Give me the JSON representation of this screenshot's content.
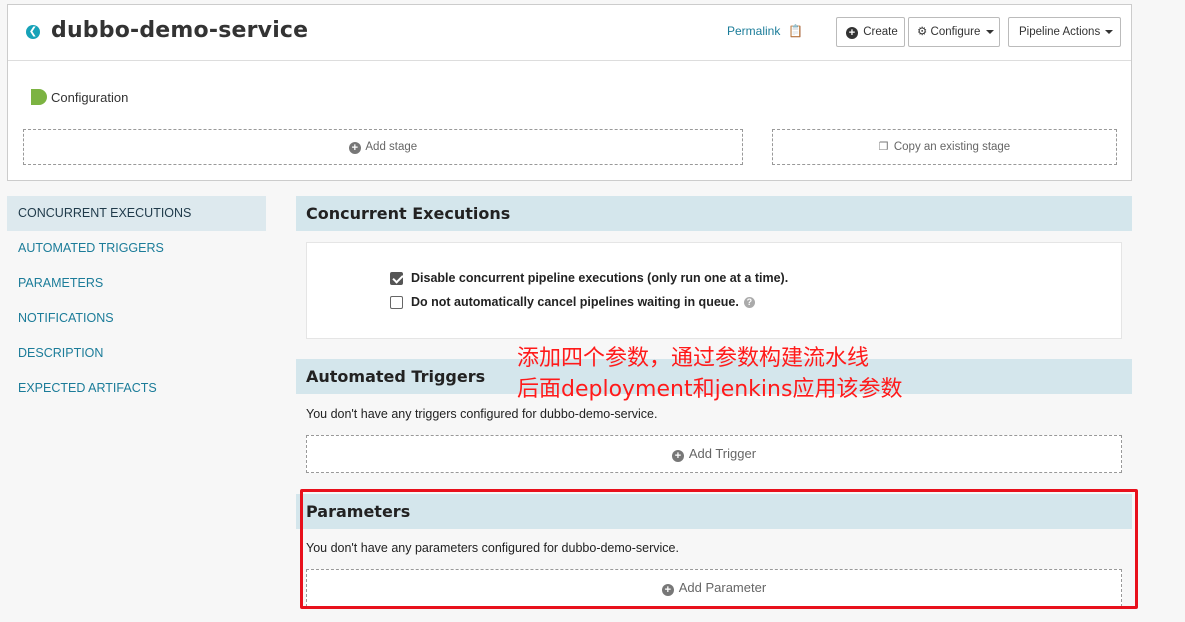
{
  "header": {
    "pipeline_name": "dubbo-demo-service",
    "permalink": "Permalink",
    "create_label": "Create",
    "configure_label": "Configure",
    "actions_label": "Pipeline Actions"
  },
  "stages": {
    "config_label": "Configuration",
    "add_stage": "Add stage",
    "copy_stage": "Copy an existing stage"
  },
  "sidebar": {
    "items": [
      {
        "label": "CONCURRENT EXECUTIONS",
        "active": true
      },
      {
        "label": "AUTOMATED TRIGGERS"
      },
      {
        "label": "PARAMETERS"
      },
      {
        "label": "NOTIFICATIONS"
      },
      {
        "label": "DESCRIPTION"
      },
      {
        "label": "EXPECTED ARTIFACTS"
      }
    ]
  },
  "concurrent": {
    "title": "Concurrent Executions",
    "option1": "Disable concurrent pipeline executions (only run one at a time).",
    "option1_checked": true,
    "option2": "Do not automatically cancel pipelines waiting in queue.",
    "option2_checked": false
  },
  "triggers": {
    "title": "Automated Triggers",
    "empty": "You don't have any triggers configured for dubbo-demo-service.",
    "add": "Add Trigger"
  },
  "parameters": {
    "title": "Parameters",
    "empty": "You don't have any parameters configured for dubbo-demo-service.",
    "add": "Add Parameter"
  },
  "annotation": {
    "line1": "添加四个参数，通过参数构建流水线",
    "line2": "后面deployment和jenkins应用该参数",
    "color": "#ff1a1a"
  },
  "colors": {
    "accent": "#1b7c99",
    "section_bg": "#d4e6ec",
    "highlight_border": "#e8101c"
  }
}
